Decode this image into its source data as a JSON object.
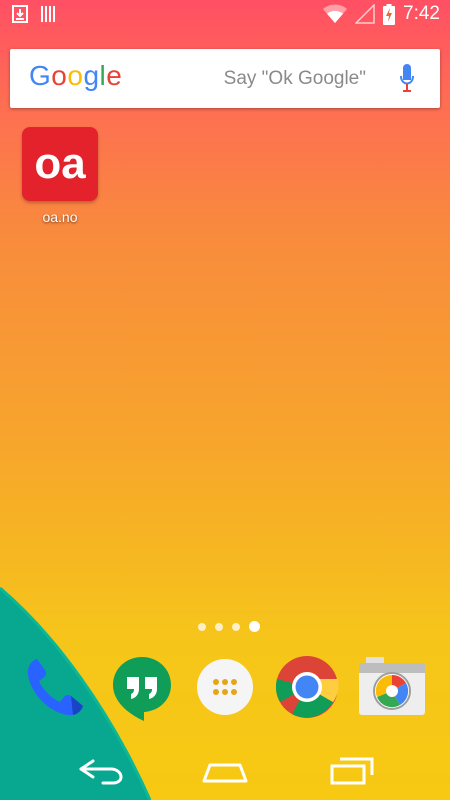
{
  "status_bar": {
    "time": "7:42",
    "icons": [
      "download-icon",
      "barcode-icon",
      "wifi-icon",
      "no-signal-icon",
      "battery-charging-icon"
    ]
  },
  "search": {
    "logo": [
      "G",
      "o",
      "o",
      "g",
      "l",
      "e"
    ],
    "hint": "Say \"Ok Google\"",
    "mic_icon": "mic-icon"
  },
  "desktop_apps": [
    {
      "label": "oa.no",
      "tile_text": "oa",
      "color": "#e3222c"
    }
  ],
  "page_indicator": {
    "count": 4,
    "active": 4
  },
  "dock": [
    "phone-icon",
    "hangouts-icon",
    "app-drawer-icon",
    "chrome-icon",
    "camera-icon"
  ],
  "nav": [
    "back-icon",
    "home-icon",
    "recents-icon"
  ],
  "colors": {
    "wallpaper_top": "#ff4f64",
    "wallpaper_bottom": "#f7c912",
    "teal": "#07a88f"
  }
}
